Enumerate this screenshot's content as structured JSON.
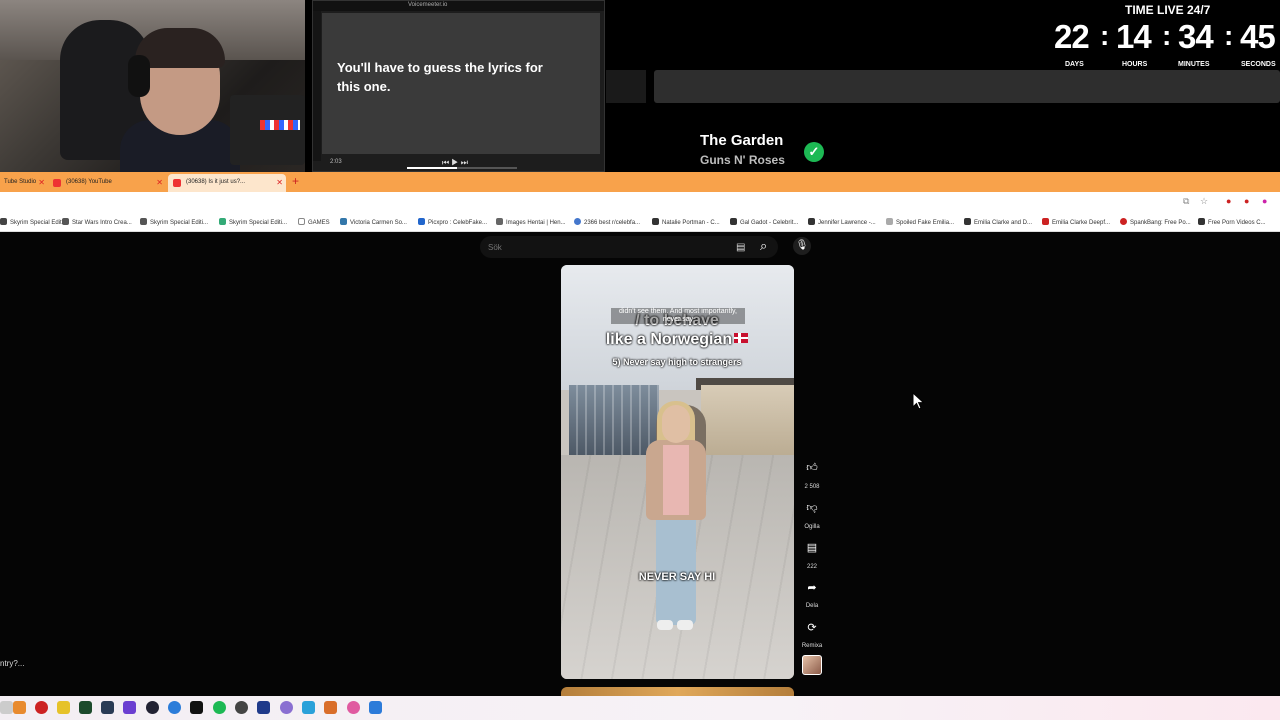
{
  "lyrics_window": {
    "title": "Voicemeeter.io",
    "text": "You'll have to guess the lyrics for this one.",
    "time_elapsed": "2:03",
    "progress": 0.45
  },
  "now_playing": {
    "title": "The Garden",
    "artist": "Guns N' Roses"
  },
  "timer": {
    "title": "TIME LIVE 24/7",
    "days": "22",
    "hours": "14",
    "minutes": "34",
    "seconds": "45",
    "days_label": "DAYS",
    "hours_label": "HOURS",
    "minutes_label": "MINUTES",
    "seconds_label": "SECONDS"
  },
  "tabs": [
    {
      "label": "Tube Studio"
    },
    {
      "label": "(30638) YouTube"
    },
    {
      "label": "(30638) Is it just us?..."
    }
  ],
  "bookmarks": [
    "Skyrim Special Editi...",
    "Star Wars Intro Crea...",
    "Skyrim Special Editi...",
    "Skyrim Special Editi...",
    "GAMES",
    "Victoria Carmen So...",
    "Picxpro : CelebFake...",
    "Images Hentai | Hen...",
    "2366 best r/celebfa...",
    "Natalie Portman - C...",
    "Gal Gadot - Celebrit...",
    "Jennifer Lawrence -...",
    "Spoiled Fake Emilia...",
    "Emilia Clarke and D...",
    "Emilia Clarke Deepf...",
    "SpankBang: Free Po...",
    "Free Porn Videos C..."
  ],
  "search": {
    "placeholder": "Sök"
  },
  "short": {
    "overlay_small": "didn't see them. And most importantly, never say",
    "overlay_line1": "/ to behave",
    "overlay_line2": "like a Norwegian",
    "overlay_tip": "5) Never say high to strangers",
    "caption": "NEVER SAY HI",
    "likes": "2 508",
    "dislike_label": "Ogilla",
    "comments": "222",
    "share_label": "Dela",
    "remix_label": "Remixa"
  },
  "left_cut_text": "ntry?...",
  "colors": {
    "tab_strip": "#f8a24b",
    "check": "#1db954",
    "page_bg": "#050505"
  }
}
